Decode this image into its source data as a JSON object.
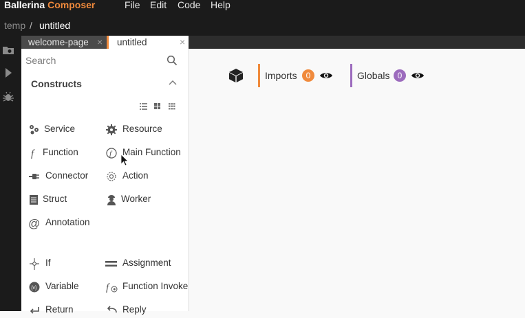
{
  "app": {
    "name": "Ballerina",
    "product": "Composer"
  },
  "menu": [
    "File",
    "Edit",
    "Code",
    "Help"
  ],
  "breadcrumb": {
    "root": "temp",
    "separator": "/",
    "file": "untitled"
  },
  "tabs": [
    {
      "label": "welcome-page",
      "active": false
    },
    {
      "label": "untitled",
      "active": true
    }
  ],
  "tab_close_glyph": "×",
  "palette": {
    "search": {
      "placeholder": "Search",
      "value": ""
    },
    "section": "Constructs",
    "view_modes": [
      "list-view-icon",
      "grid-view-icon",
      "compact-grid-icon"
    ],
    "tools": [
      {
        "label": "Service",
        "icon": "service-icon"
      },
      {
        "label": "Resource",
        "icon": "resource-icon"
      },
      {
        "label": "Function",
        "icon": "function-icon"
      },
      {
        "label": "Main Function",
        "icon": "main-function-icon"
      },
      {
        "label": "Connector",
        "icon": "connector-icon"
      },
      {
        "label": "Action",
        "icon": "action-icon"
      },
      {
        "label": "Struct",
        "icon": "struct-icon"
      },
      {
        "label": "Worker",
        "icon": "worker-icon"
      },
      {
        "label": "Annotation",
        "icon": "annotation-icon"
      },
      {
        "label": "If",
        "icon": "if-icon"
      },
      {
        "label": "Assignment",
        "icon": "assignment-icon"
      },
      {
        "label": "Variable",
        "icon": "variable-icon"
      },
      {
        "label": "Function Invoke",
        "icon": "function-invoke-icon"
      },
      {
        "label": "Return",
        "icon": "return-icon"
      },
      {
        "label": "Reply",
        "icon": "reply-icon"
      }
    ]
  },
  "canvas": {
    "package_icon": "package-icon",
    "imports": {
      "label": "Imports",
      "count": "0",
      "color": "#f08a3c"
    },
    "globals": {
      "label": "Globals",
      "count": "0",
      "color": "#9c6bbd"
    }
  },
  "colors": {
    "accent": "#f08a3c",
    "globals_accent": "#9c6bbd",
    "dark_chrome": "#1b1b1b"
  }
}
